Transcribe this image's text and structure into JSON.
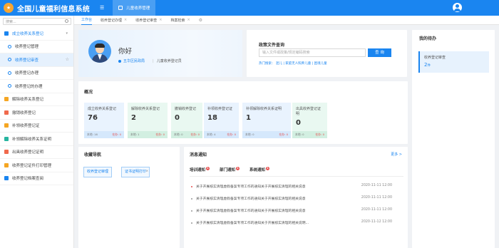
{
  "header": {
    "logo_glyph": "★",
    "app_title": "全国儿童福利信息系统",
    "menu_glyph": "☰",
    "top_tab": "儿童收养管理"
  },
  "sidebar": {
    "search_placeholder": "搜索...",
    "items": [
      {
        "label": "成立收养关系登记",
        "type": "parent",
        "color": "#1a85f0"
      },
      {
        "label": "收养登记管理",
        "type": "sub"
      },
      {
        "label": "收养登记审查",
        "type": "sub",
        "active": true
      },
      {
        "label": "收养登记办理",
        "type": "sub"
      },
      {
        "label": "收养登记的办理",
        "type": "sub"
      },
      {
        "label": "解除收养关系登记",
        "type": "item",
        "color": "#f5a623"
      },
      {
        "label": "撤销收养登记",
        "type": "item",
        "color": "#f06a4d"
      },
      {
        "label": "补领收养登记证",
        "type": "item",
        "color": "#f5a623"
      },
      {
        "label": "补领解除收养关系证明",
        "type": "item",
        "color": "#27b5a0"
      },
      {
        "label": "出具收养登记证明",
        "type": "item",
        "color": "#f06a4d"
      },
      {
        "label": "收养登记证件打印管理",
        "type": "item",
        "color": "#f5a623"
      },
      {
        "label": "收养登记档案查阅",
        "type": "item",
        "color": "#1a85f0"
      }
    ]
  },
  "tabs": [
    {
      "label": "工作台",
      "active": true
    },
    {
      "label": "收养登记办理",
      "closable": true
    },
    {
      "label": "收养登记审查",
      "closable": true
    },
    {
      "label": "档案检索",
      "closable": true
    }
  ],
  "welcome": {
    "greeting": "你好",
    "org": "五华区民政局",
    "role": "儿童收养登记员"
  },
  "policy": {
    "title": "政策文件查询",
    "placeholder": "输入文件或政策/规定编码搜索",
    "button": "查 询",
    "hot": "热门搜索：  混儿  |  家庭无人照养儿童  |  困境儿童"
  },
  "todo": {
    "title": "我的待办",
    "item_label": "收养登记审查",
    "item_count": "2",
    "item_unit": "件"
  },
  "overview": {
    "title": "概况",
    "stats": [
      {
        "name": "成立收养关系登记",
        "value": "76",
        "foot_left": "本地: 16",
        "foot_right": "在办: 0",
        "color": "blue"
      },
      {
        "name": "解除收养关系登记",
        "value": "2",
        "foot_left": "本地: 1",
        "foot_right": "在办: 0",
        "color": "green"
      },
      {
        "name": "撤销收养登记",
        "value": "0",
        "foot_left": "本地: 0",
        "foot_right": "在办: 0",
        "color": "green"
      },
      {
        "name": "补领收养登记证",
        "value": "18",
        "foot_left": "本地: 4",
        "foot_right": "在办: 0",
        "color": "blue"
      },
      {
        "name": "补领解除收养关系证明",
        "value": "1",
        "foot_left": "本地: 0",
        "foot_right": "在办: 0",
        "color": "blue"
      },
      {
        "name": "出具收养登记证明",
        "value": "0",
        "foot_left": "本地: 0",
        "foot_right": "在办: 0",
        "color": "green"
      }
    ]
  },
  "guide": {
    "title": "收藏导航",
    "chips": [
      "收养登记审理",
      "证书证明打印"
    ]
  },
  "news": {
    "title": "消息通知",
    "more": "更多 >",
    "tabs": [
      {
        "label": "培训通知",
        "count": "1"
      },
      {
        "label": "部门通知",
        "count": "1"
      },
      {
        "label": "系统通知",
        "count": "1"
      }
    ],
    "rows": [
      {
        "text": "关于开展核实清理虚假备案专项工作的通知关于开展核实清理的相关说意",
        "date": "2020-11-11 12:00",
        "red": true
      },
      {
        "text": "关于开展核实清理虚假备案专项工作的通知关于开展核实清理的相关说意",
        "date": "2020-11-11 12:00"
      },
      {
        "text": "关于开展核实清理虚假备案专项工作的通知关于开展核实清理的相关说意",
        "date": "2020-11-11 12:00"
      },
      {
        "text": "关于开展核实清理虚假备案专项工作的通知关于开展核实清理的相关说明...",
        "date": "2020-11-12 12:00"
      }
    ]
  }
}
